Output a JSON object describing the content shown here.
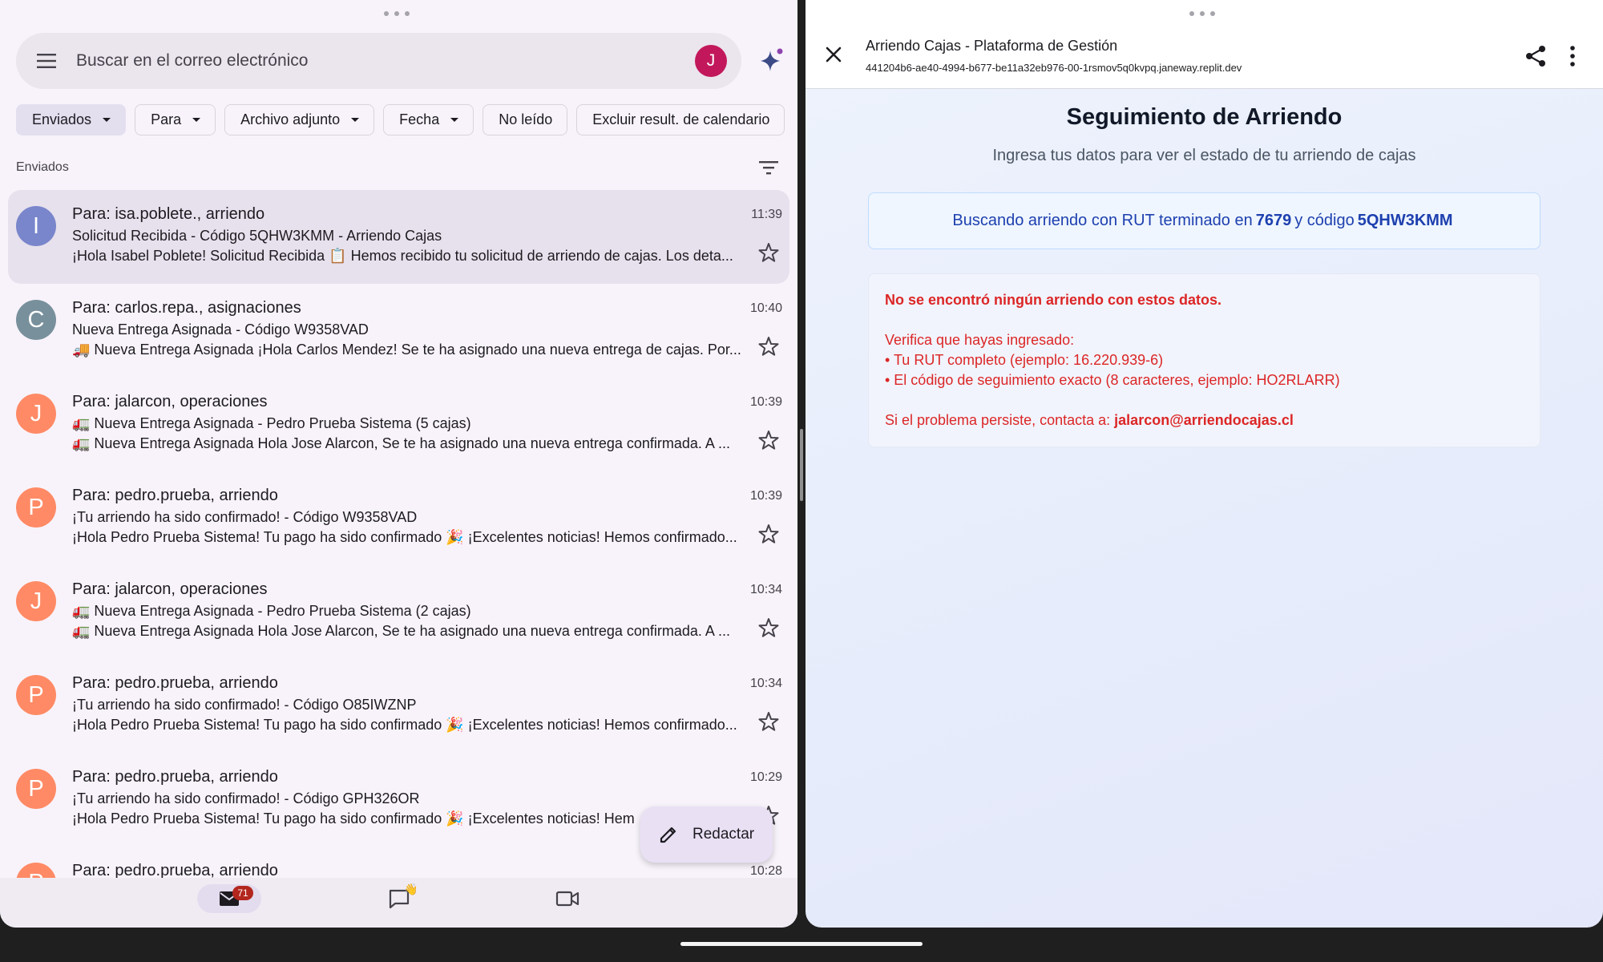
{
  "mail": {
    "search_placeholder": "Buscar en el correo electrónico",
    "account_initial": "J",
    "chips": [
      {
        "label": "Enviados",
        "dropdown": true,
        "selected": true
      },
      {
        "label": "Para",
        "dropdown": true
      },
      {
        "label": "Archivo adjunto",
        "dropdown": true
      },
      {
        "label": "Fecha",
        "dropdown": true
      },
      {
        "label": "No leído",
        "dropdown": false
      },
      {
        "label": "Excluir result. de calendario",
        "dropdown": false
      }
    ],
    "section_label": "Enviados",
    "messages": [
      {
        "initial": "I",
        "avatar_color": "#7986cb",
        "to": "Para: isa.poblete., arriendo",
        "time": "11:39",
        "subject": "Solicitud Recibida - Código 5QHW3KMM - Arriendo Cajas",
        "snippet": "¡Hola Isabel Poblete! Solicitud Recibida 📋 Hemos recibido tu solicitud de arriendo de cajas. Los deta...",
        "selected": true
      },
      {
        "initial": "C",
        "avatar_color": "#78909c",
        "to": "Para: carlos.repa., asignaciones",
        "time": "10:40",
        "subject": "Nueva Entrega Asignada - Código W9358VAD",
        "snippet": "🚚 Nueva Entrega Asignada ¡Hola Carlos Mendez! Se te ha asignado una nueva entrega de cajas. Por..."
      },
      {
        "initial": "J",
        "avatar_color": "#ff8a65",
        "to": "Para: jalarcon, operaciones",
        "time": "10:39",
        "subject": "🚛 Nueva Entrega Asignada - Pedro Prueba Sistema (5 cajas)",
        "snippet": "🚛 Nueva Entrega Asignada Hola Jose Alarcon, Se te ha asignado una nueva entrega confirmada. A ..."
      },
      {
        "initial": "P",
        "avatar_color": "#ff8a65",
        "to": "Para: pedro.prueba, arriendo",
        "time": "10:39",
        "subject": "¡Tu arriendo ha sido confirmado! - Código W9358VAD",
        "snippet": "¡Hola Pedro Prueba Sistema! Tu pago ha sido confirmado 🎉 ¡Excelentes noticias! Hemos confirmado..."
      },
      {
        "initial": "J",
        "avatar_color": "#ff8a65",
        "to": "Para: jalarcon, operaciones",
        "time": "10:34",
        "subject": "🚛 Nueva Entrega Asignada - Pedro Prueba Sistema (2 cajas)",
        "snippet": "🚛 Nueva Entrega Asignada Hola Jose Alarcon, Se te ha asignado una nueva entrega confirmada. A ..."
      },
      {
        "initial": "P",
        "avatar_color": "#ff8a65",
        "to": "Para: pedro.prueba, arriendo",
        "time": "10:34",
        "subject": "¡Tu arriendo ha sido confirmado! - Código O85IWZNP",
        "snippet": "¡Hola Pedro Prueba Sistema! Tu pago ha sido confirmado 🎉 ¡Excelentes noticias! Hemos confirmado..."
      },
      {
        "initial": "P",
        "avatar_color": "#ff8a65",
        "to": "Para: pedro.prueba, arriendo",
        "time": "10:29",
        "subject": "¡Tu arriendo ha sido confirmado! - Código GPH326OR",
        "snippet": "¡Hola Pedro Prueba Sistema! Tu pago ha sido confirmado 🎉 ¡Excelentes noticias! Hem"
      },
      {
        "initial": "P",
        "avatar_color": "#ff8a65",
        "to": "Para: pedro.prueba, arriendo",
        "time": "10:28",
        "subject": "",
        "snippet": ""
      }
    ],
    "compose_label": "Redactar",
    "nav": {
      "mail_badge": "71"
    }
  },
  "browser": {
    "title": "Arriendo Cajas - Plataforma de Gestión",
    "url": "441204b6-ae40-4994-b677-be11a32eb976-00-1rsmov5q0kvpq.janeway.replit.dev"
  },
  "page": {
    "heading": "Seguimiento de Arriendo",
    "subheading": "Ingresa tus datos para ver el estado de tu arriendo de cajas",
    "search": {
      "prefix": "Buscando arriendo con RUT terminado en",
      "rut_suffix": "7679",
      "middle": "y código",
      "code": "5QHW3KMM"
    },
    "error": {
      "title": "No se encontró ningún arriendo con estos datos.",
      "line1": "Verifica que hayas ingresado:",
      "line2": "• Tu RUT completo (ejemplo: 16.220.939-6)",
      "line3": "• El código de seguimiento exacto (8 caracteres, ejemplo: HO2RLARR)",
      "contact_prefix": "Si el problema persiste, contacta a:",
      "contact_email": "jalarcon@arriendocajas.cl"
    }
  },
  "colors": {
    "accent_blue": "#1e40af",
    "error_red": "#dc2626",
    "badge_red": "#b3261e"
  }
}
